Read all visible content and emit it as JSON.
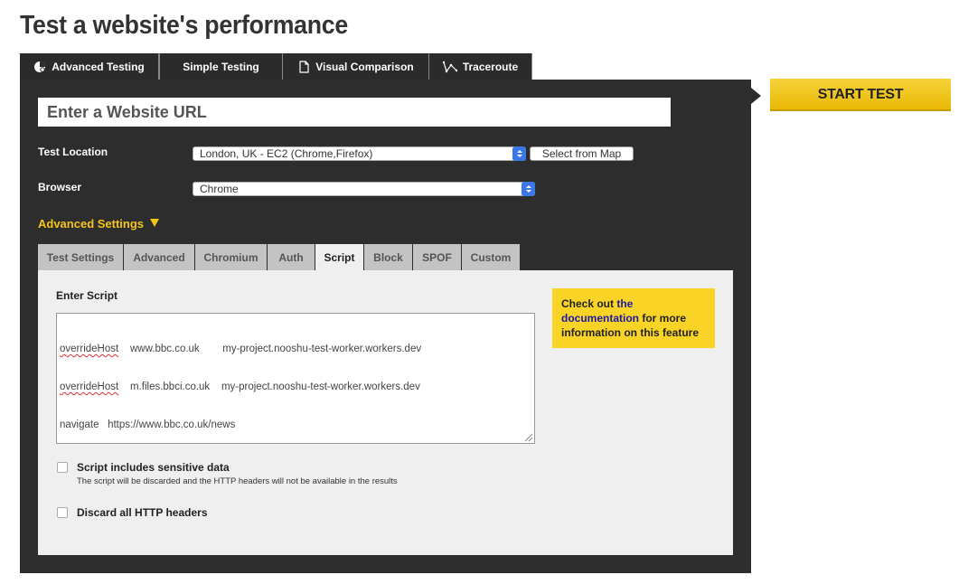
{
  "page": {
    "title": "Test a website's performance"
  },
  "main_tabs": [
    {
      "label": "Advanced Testing",
      "icon": "advanced-testing-icon"
    },
    {
      "label": "Simple Testing",
      "icon": ""
    },
    {
      "label": "Visual Comparison",
      "icon": "document-icon"
    },
    {
      "label": "Traceroute",
      "icon": "traceroute-icon"
    }
  ],
  "url_input": {
    "placeholder": "Enter a Website URL"
  },
  "test_location": {
    "label": "Test Location",
    "value": "London, UK - EC2 (Chrome,Firefox)",
    "map_button": "Select from Map"
  },
  "browser": {
    "label": "Browser",
    "value": "Chrome"
  },
  "advanced_settings": {
    "label": "Advanced Settings"
  },
  "sub_tabs": [
    "Test Settings",
    "Advanced",
    "Chromium",
    "Auth",
    "Script",
    "Block",
    "SPOF",
    "Custom"
  ],
  "script": {
    "label": "Enter Script",
    "lines": [
      {
        "cmd": "overrideHost",
        "host": "www.bbc.co.uk",
        "target": "my-project.nooshu-test-worker.workers.dev"
      },
      {
        "cmd": "overrideHost",
        "host": "m.files.bbci.co.uk",
        "target": "my-project.nooshu-test-worker.workers.dev"
      },
      {
        "cmd": "navigate",
        "host": "https://www.bbc.co.uk/news",
        "target": ""
      }
    ]
  },
  "info": {
    "prefix": "Check out ",
    "link1": "the",
    "link2": "documentation",
    "suffix": " for more information on this feature"
  },
  "options": {
    "sensitive": {
      "label": "Script includes sensitive data",
      "hint": "The script will be discarded and the HTTP headers will not be available in the results"
    },
    "discard": {
      "label": "Discard all HTTP headers"
    }
  },
  "start_button": {
    "label": "START TEST"
  },
  "colors": {
    "panel": "#2d2d2d",
    "accent": "#f5c518",
    "link": "#1a1aa6"
  }
}
